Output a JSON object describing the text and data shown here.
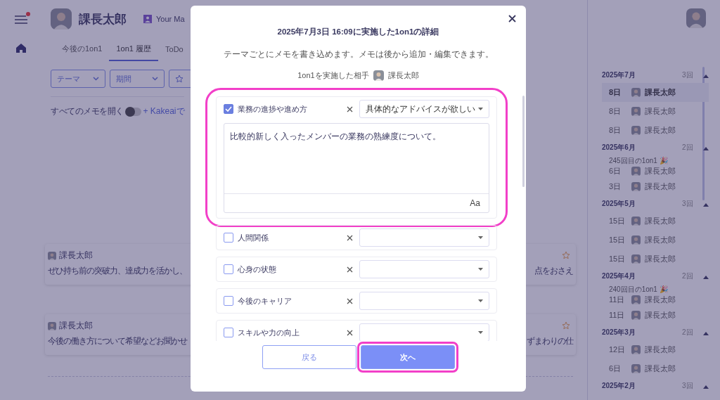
{
  "menu": {
    "has_notification": true
  },
  "header": {
    "user_name": "課長太郎",
    "link": "Your Ma"
  },
  "tabs": [
    {
      "label": "今後の1on1",
      "selected": false
    },
    {
      "label": "1on1 履歴",
      "selected": true
    },
    {
      "label": "ToDo",
      "selected": false
    }
  ],
  "filters": [
    {
      "kind": "dropdown",
      "label": "テーマ"
    },
    {
      "kind": "dropdown",
      "label": "期間"
    },
    {
      "kind": "star"
    }
  ],
  "memo_toggle": {
    "label": "すべてのメモを開く",
    "on": false
  },
  "add_link": "+ Kakeaiで",
  "memo_cards": [
    {
      "author": "課長太郎",
      "text": "ぜひ持ち前の突破力、達成力を活かし、",
      "text_right": "点をおさえ",
      "starred": false
    },
    {
      "author": "課長太郎",
      "text": "今後の働き方について希望などお聞かせ",
      "text_right": "ずまわりの仕",
      "starred": false
    }
  ],
  "history": {
    "groups": [
      {
        "month": "2025年7月",
        "count": "3回",
        "expanded": true,
        "items": [
          {
            "day": "8日",
            "name": "課長太郎",
            "selected": true
          },
          {
            "day": "8日",
            "name": "課長太郎",
            "selected": false
          },
          {
            "day": "8日",
            "name": "課長太郎",
            "selected": false
          }
        ]
      },
      {
        "month": "2025年6月",
        "count": "2回",
        "expanded": true,
        "items": [
          {
            "note": "245回目の1on1 🎉",
            "day": "6日",
            "name": "課長太郎",
            "selected": false
          },
          {
            "day": "3日",
            "name": "課長太郎",
            "selected": false
          }
        ]
      },
      {
        "month": "2025年5月",
        "count": "3回",
        "expanded": true,
        "items": [
          {
            "day": "15日",
            "name": "課長太郎",
            "selected": false
          },
          {
            "day": "15日",
            "name": "課長太郎",
            "selected": false
          },
          {
            "day": "15日",
            "name": "課長太郎",
            "selected": false
          }
        ]
      },
      {
        "month": "2025年4月",
        "count": "2回",
        "expanded": true,
        "items": [
          {
            "note": "240回目の1on1 🎉",
            "day": "11日",
            "name": "課長太郎",
            "selected": false
          },
          {
            "day": "11日",
            "name": "課長太郎",
            "selected": false
          }
        ]
      },
      {
        "month": "2025年3月",
        "count": "2回",
        "expanded": true,
        "items": [
          {
            "day": "12日",
            "name": "課長太郎",
            "selected": false
          },
          {
            "day": "6日",
            "name": "課長太郎",
            "selected": false
          }
        ]
      },
      {
        "month": "2025年2月",
        "count": "3回",
        "expanded": true
      }
    ]
  },
  "modal": {
    "title": "2025年7月3日 16:09に実施した1on1の詳細",
    "subtitle": "テーマごとにメモを書き込めます。メモは後から追加・編集できます。",
    "partner_label": "1on1を実施した相手",
    "partner_name": "課長太郎",
    "themes": [
      {
        "label": "業務の進捗や進め方",
        "checked": true,
        "highlighted": true,
        "request": "具体的なアドバイスが欲しい",
        "memo": "比較的新しく入ったメンバーの業務の熟練度について。",
        "format_label": "Aa"
      },
      {
        "label": "人間関係",
        "checked": false,
        "highlighted": false
      },
      {
        "label": "心身の状態",
        "checked": false,
        "highlighted": false
      },
      {
        "label": "今後のキャリア",
        "checked": false,
        "highlighted": false
      },
      {
        "label": "スキルや力の向上",
        "checked": false,
        "highlighted": false
      }
    ],
    "buttons": [
      {
        "label": "戻る",
        "kind": "secondary",
        "highlighted": false
      },
      {
        "label": "次へ",
        "kind": "primary",
        "highlighted": true
      }
    ]
  }
}
